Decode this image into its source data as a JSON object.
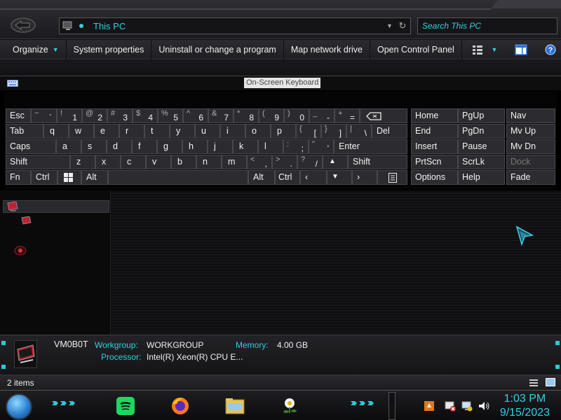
{
  "address": {
    "path": "This PC"
  },
  "search": {
    "placeholder": "Search This PC"
  },
  "toolbar": {
    "items": [
      "Organize",
      "System properties",
      "Uninstall or change a program",
      "Map network drive",
      "Open Control Panel"
    ]
  },
  "osk": {
    "title": "On-Screen Keyboard",
    "row1": {
      "esc": "Esc",
      "keys": [
        {
          "sub": "~",
          "main": "`"
        },
        {
          "sub": "!",
          "main": "1"
        },
        {
          "sub": "@",
          "main": "2"
        },
        {
          "sub": "#",
          "main": "3"
        },
        {
          "sub": "$",
          "main": "4"
        },
        {
          "sub": "%",
          "main": "5"
        },
        {
          "sub": "^",
          "main": "6"
        },
        {
          "sub": "&",
          "main": "7"
        },
        {
          "sub": "*",
          "main": "8"
        },
        {
          "sub": "(",
          "main": "9"
        },
        {
          "sub": ")",
          "main": "0"
        },
        {
          "sub": "_",
          "main": "-"
        },
        {
          "sub": "+",
          "main": "="
        }
      ]
    },
    "row2": {
      "tab": "Tab",
      "letters": [
        "q",
        "w",
        "e",
        "r",
        "t",
        "y",
        "u",
        "i",
        "o",
        "p"
      ],
      "brackets": [
        {
          "sub": "{",
          "main": "["
        },
        {
          "sub": "}",
          "main": "]"
        },
        {
          "sub": "|",
          "main": "\\"
        }
      ],
      "del": "Del"
    },
    "row3": {
      "caps": "Caps",
      "letters": [
        "a",
        "s",
        "d",
        "f",
        "g",
        "h",
        "j",
        "k",
        "l"
      ],
      "punct": [
        {
          "sub": ":",
          "main": ";"
        },
        {
          "sub": "\"",
          "main": "'"
        }
      ],
      "enter": "Enter"
    },
    "row4": {
      "shift_left": "Shift",
      "letters": [
        "z",
        "x",
        "c",
        "v",
        "b",
        "n",
        "m"
      ],
      "punct": [
        {
          "sub": "<",
          "main": ","
        },
        {
          "sub": ">",
          "main": "."
        },
        {
          "sub": "?",
          "main": "/"
        }
      ],
      "shift_right": "Shift"
    },
    "row5": {
      "fn": "Fn",
      "ctrl": "Ctrl",
      "alt": "Alt",
      "alt_right": "Alt",
      "ctrl_right": "Ctrl"
    },
    "nav": [
      [
        "Home",
        "PgUp",
        "Nav"
      ],
      [
        "End",
        "PgDn",
        "Mv Up"
      ],
      [
        "Insert",
        "Pause",
        "Mv Dn"
      ],
      [
        "PrtScn",
        "ScrLk",
        "Dock"
      ],
      [
        "Options",
        "Help",
        "Fade"
      ]
    ]
  },
  "details": {
    "computer_name": "VM0B0T",
    "workgroup_label": "Workgroup:",
    "workgroup_value": "WORKGROUP",
    "memory_label": "Memory:",
    "memory_value": "4.00 GB",
    "processor_label": "Processor:",
    "processor_value": "Intel(R) Xeon(R) CPU E..."
  },
  "status": {
    "items": "2 items"
  },
  "clock": {
    "time": "1:03 PM",
    "date": "9/15/2023"
  },
  "colors": {
    "accent": "#30d0e0",
    "background": "#0c0c0e",
    "key_face": "#2c2c30"
  }
}
